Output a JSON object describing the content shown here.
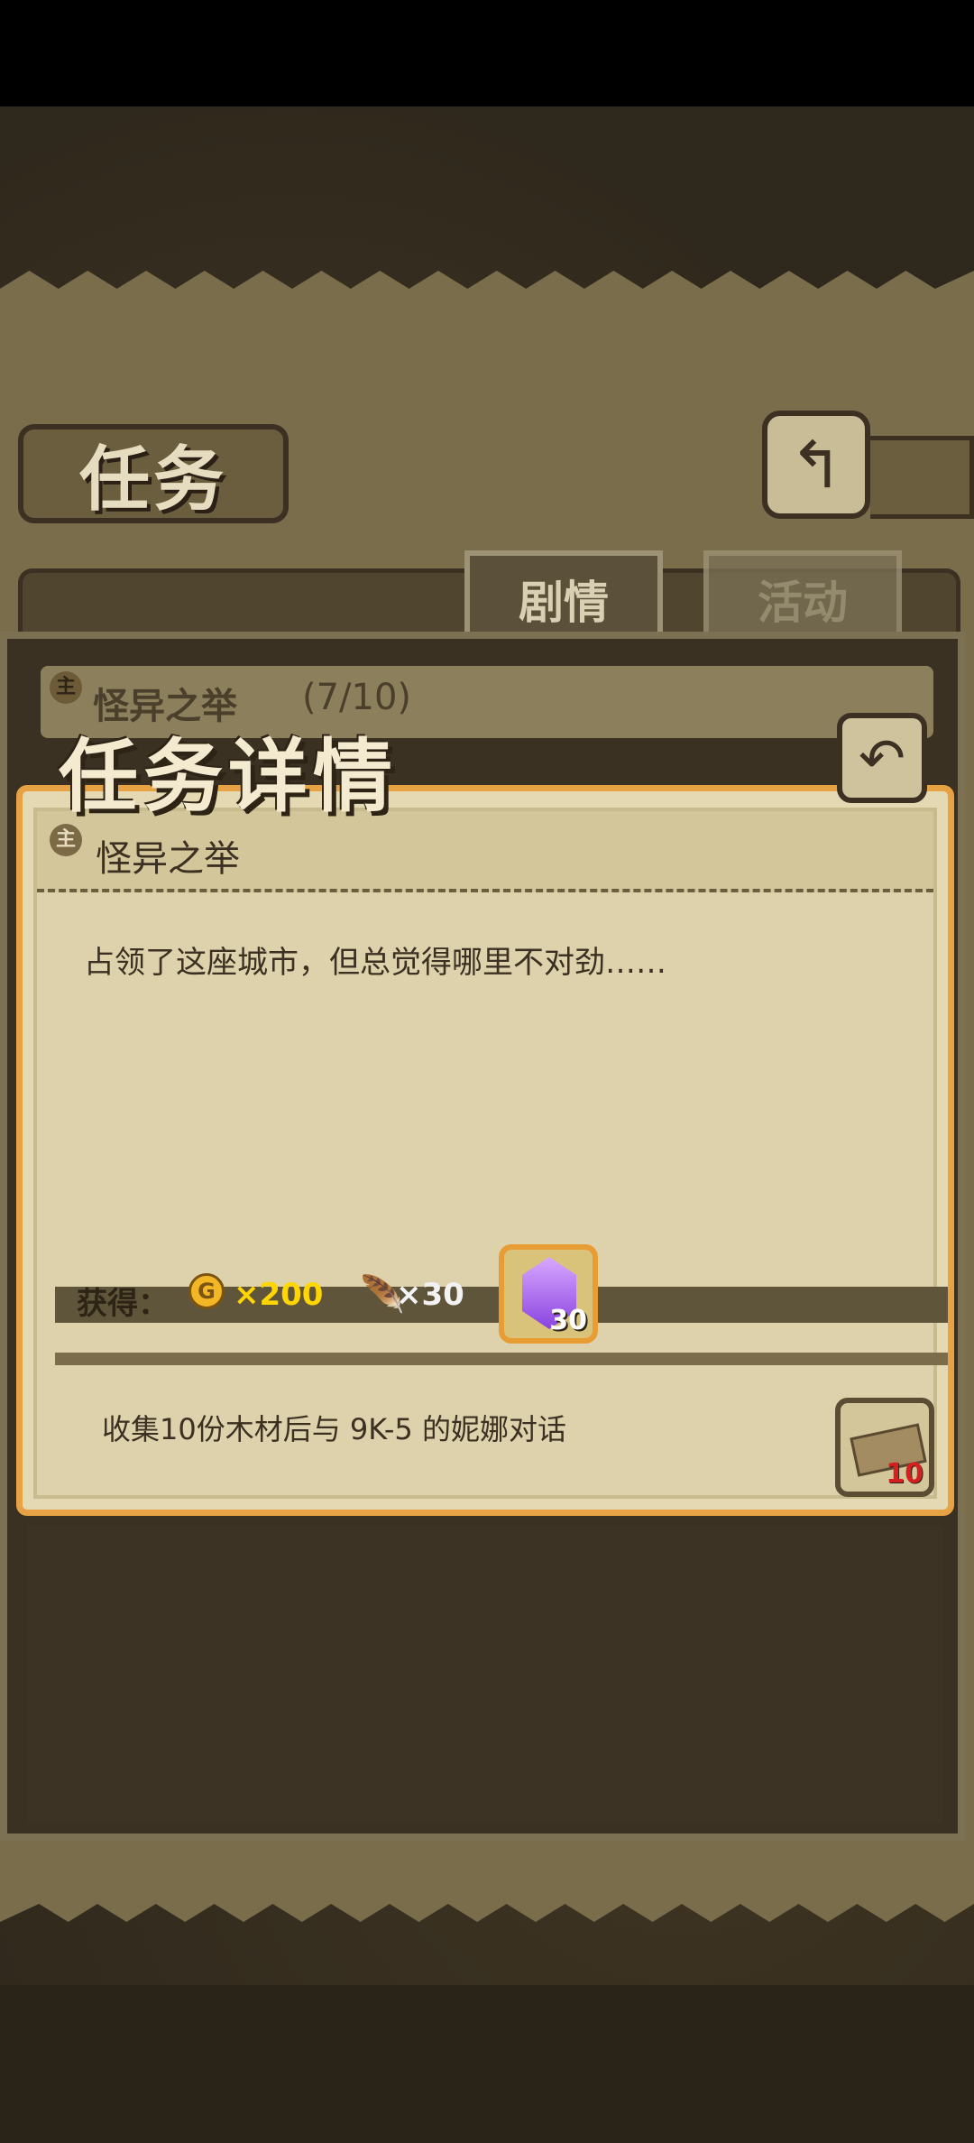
{
  "screen": {
    "title": "任务",
    "tabs": [
      {
        "label": "剧情",
        "active": true
      },
      {
        "label": "活动",
        "active": false
      }
    ],
    "quest_list": [
      {
        "badge": "主",
        "name": "怪异之举",
        "progress": "(7/10)"
      }
    ]
  },
  "modal": {
    "title": "任务详情",
    "quest_badge": "主",
    "quest_name": "怪异之举",
    "description": "占领了这座城市，但总觉得哪里不对劲……",
    "rewards_label": "获得：",
    "rewards": [
      {
        "icon": "gold-coin-icon",
        "coin_glyph": "G",
        "text": "×200"
      },
      {
        "icon": "feather-icon",
        "glyph": "🪶",
        "text": "×30"
      },
      {
        "icon": "purple-gem-icon",
        "count": "30"
      }
    ],
    "objective": "收集10份木材后与 9K-5 的妮娜对话",
    "objective_item": {
      "icon": "wood-plank-icon",
      "count": "10"
    }
  },
  "icons": {
    "back": "↰",
    "return": "↶"
  },
  "colors": {
    "accent_orange": "#e7a243",
    "coin_yellow": "#ffd600",
    "wood_count_red": "#d62020"
  }
}
